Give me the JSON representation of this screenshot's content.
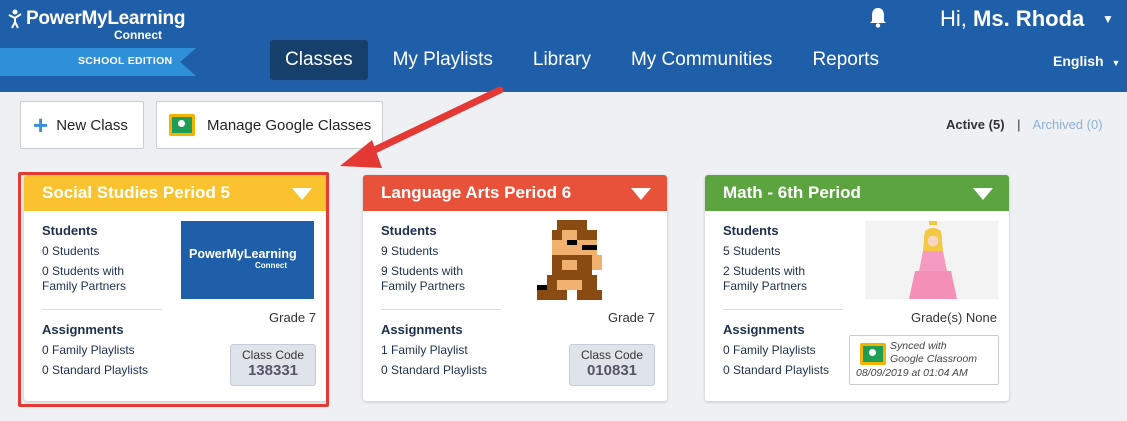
{
  "header": {
    "brand": "PowerMyLearning",
    "brand_sub": "Connect",
    "edition": "SCHOOL EDITION",
    "nav": [
      {
        "label": "Classes",
        "active": true
      },
      {
        "label": "My Playlists"
      },
      {
        "label": "Library"
      },
      {
        "label": "My Communities"
      },
      {
        "label": "Reports"
      }
    ],
    "greeting_prefix": "Hi,",
    "user_name": "Ms. Rhoda",
    "language": "English"
  },
  "toolbar": {
    "new_class": "New Class",
    "manage_google": "Manage Google Classes",
    "filter_active": "Active (5)",
    "filter_sep": "|",
    "filter_archived": "Archived (0)"
  },
  "labels": {
    "students": "Students",
    "assignments": "Assignments",
    "class_code": "Class Code"
  },
  "cards": [
    {
      "title": "Social Studies Period 5",
      "color": "#f9c22e",
      "students_count": "0 Students",
      "family_partners_1": "0 Students with",
      "family_partners_2": "Family Partners",
      "family_playlists": "0 Family Playlists",
      "standard_playlists": "0 Standard Playlists",
      "grade": "Grade 7",
      "class_code": "138331",
      "image_brand": "PowerMyLearning",
      "image_brand_sub": "Connect"
    },
    {
      "title": "Language Arts Period 6",
      "color": "#e9523a",
      "students_count": "9 Students",
      "family_partners_1": "9 Students with",
      "family_partners_2": "Family Partners",
      "family_playlists": "1 Family Playlist",
      "standard_playlists": "0 Standard Playlists",
      "grade": "Grade 7",
      "class_code": "010831"
    },
    {
      "title": "Math - 6th Period",
      "color": "#5ca43f",
      "students_count": "5 Students",
      "family_partners_1": "2 Students with",
      "family_partners_2": "Family Partners",
      "family_playlists": "0 Family Playlists",
      "standard_playlists": "0 Standard Playlists",
      "grade": "Grade(s) None",
      "sync_line1": "Synced with",
      "sync_line2": "Google Classroom",
      "sync_date": "08/09/2019 at 01:04 AM"
    }
  ],
  "colors": {
    "header_bg": "#1f5ea8",
    "highlight": "#e53935"
  }
}
